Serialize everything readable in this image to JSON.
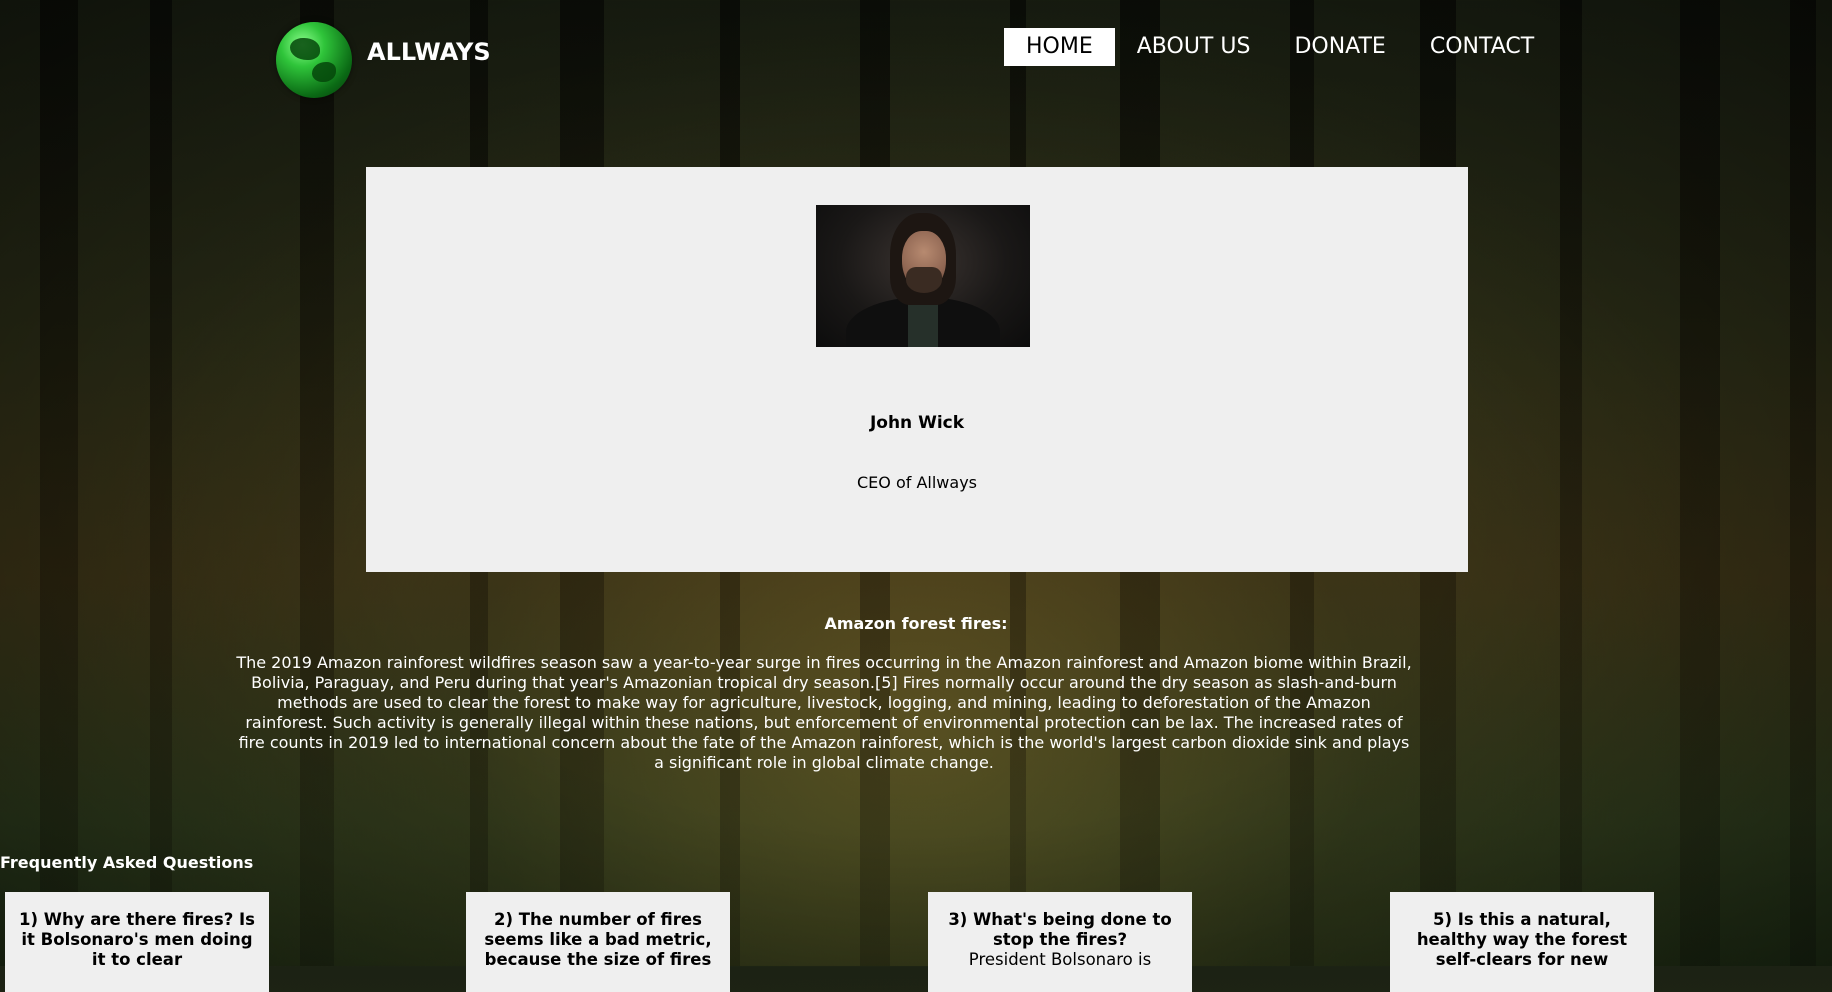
{
  "brand": {
    "name": "ALLWAYS",
    "logo_icon": "globe-icon"
  },
  "nav": {
    "items": [
      {
        "label": "HOME",
        "active": true
      },
      {
        "label": "ABOUT US",
        "active": false
      },
      {
        "label": "DONATE",
        "active": false
      },
      {
        "label": "CONTACT",
        "active": false
      }
    ]
  },
  "profile": {
    "name": "John Wick",
    "role": "CEO of Allways"
  },
  "article": {
    "title": "Amazon forest fires:",
    "body": "The 2019 Amazon rainforest wildfires season saw a year-to-year surge in fires occurring in the Amazon rainforest and Amazon biome within Brazil, Bolivia, Paraguay, and Peru during that year's Amazonian tropical dry season.[5] Fires normally occur around the dry season as slash-and-burn methods are used to clear the forest to make way for agriculture, livestock, logging, and mining, leading to deforestation of the Amazon rainforest. Such activity is generally illegal within these nations, but enforcement of environmental protection can be lax. The increased rates of fire counts in 2019 led to international concern about the fate of the Amazon rainforest, which is the world's largest carbon dioxide sink and plays a significant role in global climate change."
  },
  "faq": {
    "title": "Frequently Asked Questions",
    "items": [
      {
        "question": "1) Why are there fires? Is it Bolsonaro's men doing it to clear",
        "answer": ""
      },
      {
        "question": "2) The number of fires seems like a bad metric, because the size of fires",
        "answer": ""
      },
      {
        "question": "3) What's being done to stop the fires?",
        "answer": "President Bolsonaro is"
      },
      {
        "question": "5) Is this a natural, healthy way the forest self-clears for new",
        "answer": ""
      }
    ]
  }
}
